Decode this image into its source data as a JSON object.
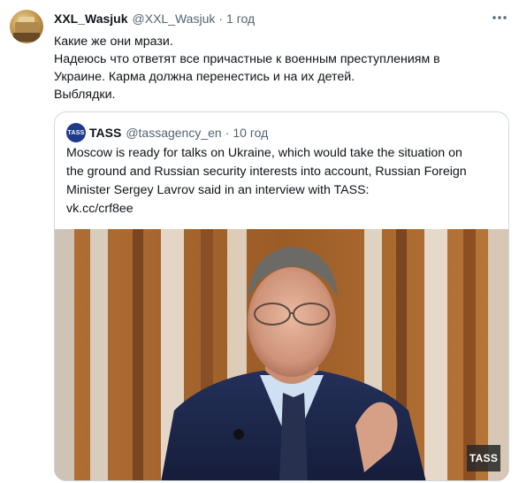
{
  "tweet": {
    "author_name": "XXL_Wasjuk",
    "author_handle": "@XXL_Wasjuk",
    "separator": "·",
    "time": "1 год",
    "text_lines": [
      "Какие же они мрази.",
      "Надеюсь что ответят все причастные к военным преступлениям в",
      "Украине. Карма должна перенестись и на их детей.",
      "Выблядки."
    ]
  },
  "quoted_tweet": {
    "avatar_label": "TASS",
    "author_name": "TASS",
    "author_handle": "@tassagency_en",
    "separator": "·",
    "time": "10 год",
    "text_lines": [
      "Moscow is ready for talks on Ukraine, which would take the situation on",
      "the ground and Russian security interests into account, Russian Foreign",
      "Minister Sergey Lavrov said in an interview with TASS:",
      "vk.cc/crf8ee"
    ],
    "photo_watermark": "TASS"
  },
  "icons": {
    "more": "more-horizontal-icon"
  },
  "colors": {
    "text": "#0f1419",
    "secondary_text": "#536471",
    "border": "#cfd9de"
  }
}
